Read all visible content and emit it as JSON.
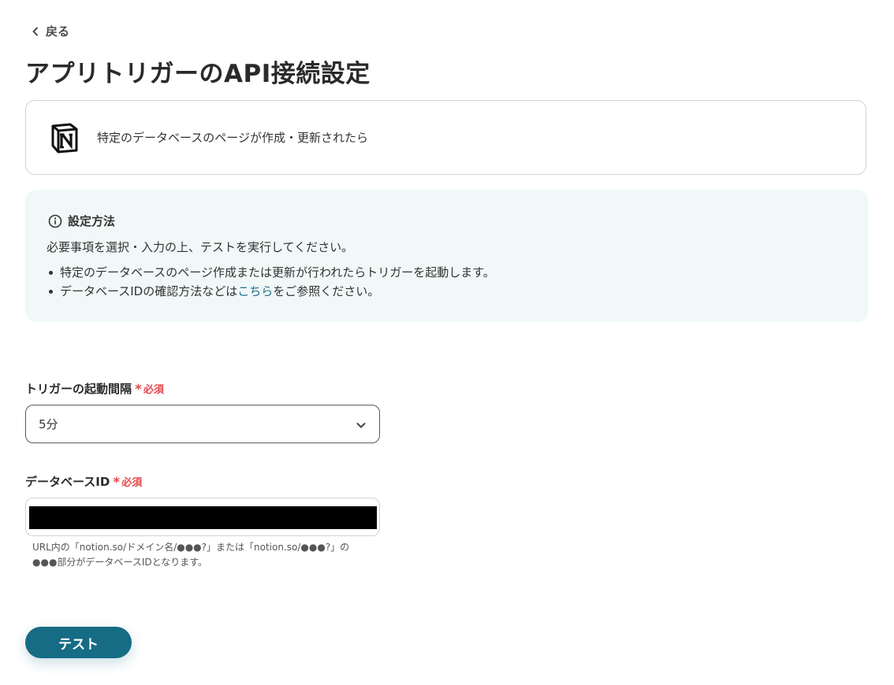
{
  "nav": {
    "back_label": "戻る"
  },
  "page": {
    "title": "アプリトリガーのAPI接続設定"
  },
  "trigger": {
    "app_icon": "notion-logo",
    "description": "特定のデータベースのページが作成・更新されたら"
  },
  "info": {
    "title": "設定方法",
    "intro": "必要事項を選択・入力の上、テストを実行してください。",
    "bullet_1": "特定のデータベースのページ作成または更新が行われたらトリガーを起動します。",
    "bullet_2_prefix": "データベースIDの確認方法などは",
    "bullet_2_link": "こちら",
    "bullet_2_suffix": "をご参照ください。"
  },
  "fields": {
    "interval": {
      "label": "トリガーの起動間隔",
      "required_mark": "*",
      "required_text": "必須",
      "selected_value": "5分"
    },
    "database_id": {
      "label": "データベースID",
      "required_mark": "*",
      "required_text": "必須",
      "value": "",
      "helper_line_1": "URL内の「notion.so/ドメイン名/●●●?」または「notion.so/●●●?」の",
      "helper_line_2": "●●●部分がデータベースIDとなります。"
    }
  },
  "actions": {
    "test_label": "テスト"
  },
  "colors": {
    "primary": "#166b85",
    "link": "#1b6d8a",
    "required": "#e5484d",
    "info_bg": "#f0f8f8",
    "border": "#cfd4d8"
  }
}
